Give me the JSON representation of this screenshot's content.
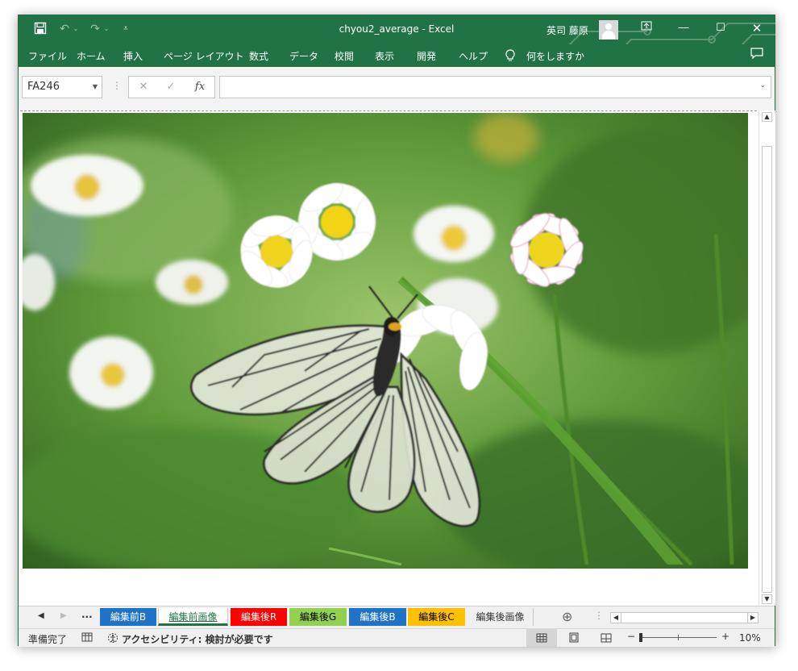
{
  "titlebar": {
    "title": "chyou2_average  -  Excel",
    "user_name": "英司 藤原",
    "qat": {
      "save_icon": "save-icon",
      "undo_icon": "undo-icon",
      "redo_icon": "redo-icon",
      "customize_icon": "customize-qat-icon"
    }
  },
  "menu": {
    "items": [
      "ファイル",
      "ホーム",
      "挿入",
      "ページ レイアウト",
      "数式",
      "データ",
      "校閲",
      "表示",
      "開発",
      "ヘルプ"
    ],
    "tell_me": "何をしますか"
  },
  "formula_bar": {
    "name_box": "FA246",
    "cancel_symbol": "✕",
    "enter_symbol": "✓",
    "fx_symbol": "fx",
    "formula": ""
  },
  "sheet_tabs": {
    "ellipsis": "...",
    "tabs": [
      {
        "label": "編集前B",
        "bg": "#1e73c8",
        "fg": "#ffffff"
      },
      {
        "label": "編集前画像",
        "bg": "#ffffff",
        "fg": "#217346"
      },
      {
        "label": "編集後R",
        "bg": "#ff0000",
        "fg": "#ffffff"
      },
      {
        "label": "編集後G",
        "bg": "#92d050",
        "fg": "#000000"
      },
      {
        "label": "編集後B",
        "bg": "#1e73c8",
        "fg": "#ffffff"
      },
      {
        "label": "編集後C",
        "bg": "#ffc000",
        "fg": "#000000"
      },
      {
        "label": "編集後画像",
        "bg": "#f0f0f0",
        "fg": "#333333"
      }
    ]
  },
  "status_bar": {
    "ready": "準備完了",
    "accessibility": "アクセシビリティ: 検討が必要です",
    "zoom_minus": "−",
    "zoom_plus": "+",
    "zoom_level": "10%"
  },
  "colors": {
    "brand": "#217346",
    "ribbon_bg": "#f3f3f3",
    "status_bg": "#f0f0f0"
  }
}
